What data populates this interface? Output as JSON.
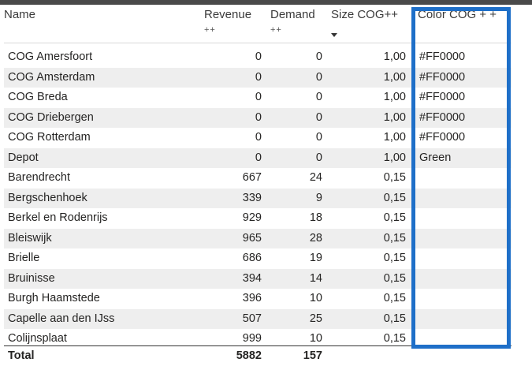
{
  "table": {
    "headers": {
      "name": "Name",
      "revenue": "Revenue",
      "revenue_sub": "++",
      "demand": "Demand",
      "demand_sub": "++",
      "size": "Size COG++",
      "color": "Color COG + +"
    },
    "rows": [
      {
        "name": "COG Amersfoort",
        "revenue": "0",
        "demand": "0",
        "size": "1,00",
        "color": "#FF0000"
      },
      {
        "name": "COG Amsterdam",
        "revenue": "0",
        "demand": "0",
        "size": "1,00",
        "color": "#FF0000"
      },
      {
        "name": "COG Breda",
        "revenue": "0",
        "demand": "0",
        "size": "1,00",
        "color": "#FF0000"
      },
      {
        "name": "COG Driebergen",
        "revenue": "0",
        "demand": "0",
        "size": "1,00",
        "color": "#FF0000"
      },
      {
        "name": "COG Rotterdam",
        "revenue": "0",
        "demand": "0",
        "size": "1,00",
        "color": "#FF0000"
      },
      {
        "name": "Depot",
        "revenue": "0",
        "demand": "0",
        "size": "1,00",
        "color": "Green"
      },
      {
        "name": "Barendrecht",
        "revenue": "667",
        "demand": "24",
        "size": "0,15",
        "color": ""
      },
      {
        "name": "Bergschenhoek",
        "revenue": "339",
        "demand": "9",
        "size": "0,15",
        "color": ""
      },
      {
        "name": "Berkel en Rodenrijs",
        "revenue": "929",
        "demand": "18",
        "size": "0,15",
        "color": ""
      },
      {
        "name": "Bleiswijk",
        "revenue": "965",
        "demand": "28",
        "size": "0,15",
        "color": ""
      },
      {
        "name": "Brielle",
        "revenue": "686",
        "demand": "19",
        "size": "0,15",
        "color": ""
      },
      {
        "name": "Bruinisse",
        "revenue": "394",
        "demand": "14",
        "size": "0,15",
        "color": ""
      },
      {
        "name": "Burgh Haamstede",
        "revenue": "396",
        "demand": "10",
        "size": "0,15",
        "color": ""
      },
      {
        "name": "Capelle aan den IJss",
        "revenue": "507",
        "demand": "25",
        "size": "0,15",
        "color": ""
      },
      {
        "name": "Colijnsplaat",
        "revenue": "999",
        "demand": "10",
        "size": "0,15",
        "color": ""
      }
    ],
    "total": {
      "label": "Total",
      "revenue": "5882",
      "demand": "157"
    }
  },
  "colors": {
    "highlight": "#1e6fc8",
    "alt_row": "#eeeeee"
  }
}
